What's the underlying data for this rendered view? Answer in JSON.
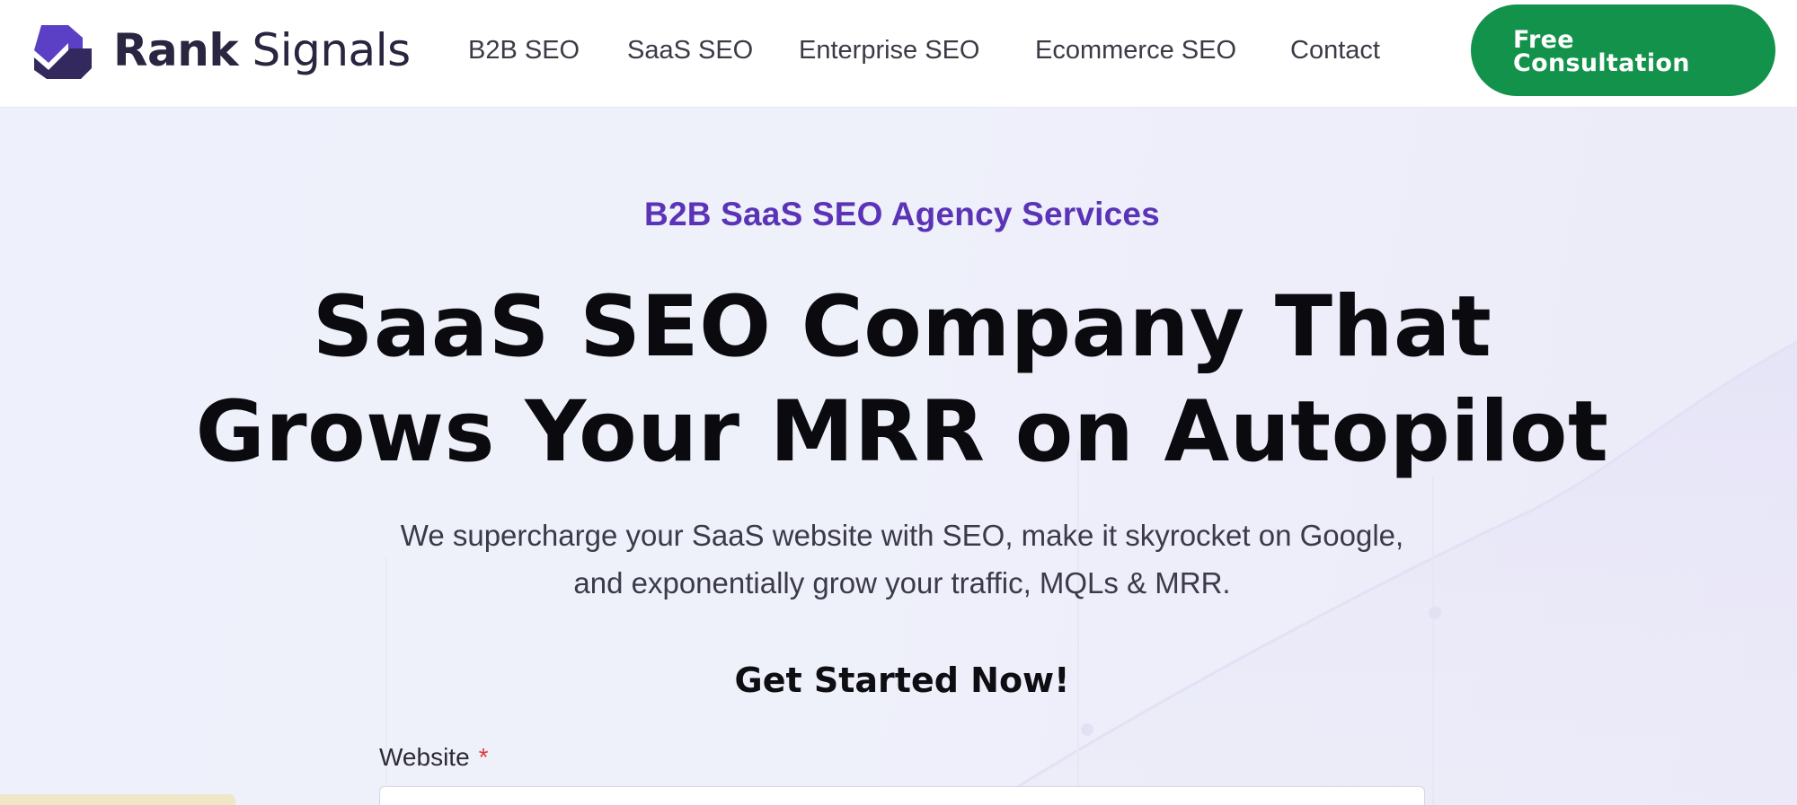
{
  "brand": {
    "name_bold": "Rank",
    "name_light": "Signals",
    "accent": "#3a2a78"
  },
  "nav": {
    "items": [
      "B2B SEO",
      "SaaS SEO",
      "Enterprise SEO",
      "Ecommerce SEO",
      "Contact"
    ],
    "cta_line1": "Free",
    "cta_line2": "Consultation",
    "cta_color": "#12924a"
  },
  "hero": {
    "eyebrow": "B2B SaaS SEO Agency Services",
    "title_line1": "SaaS SEO Company That",
    "title_line2": "Grows Your MRR on Autopilot",
    "subtitle_line1": "We supercharge your SaaS website with SEO, make it skyrocket on Google,",
    "subtitle_line2": "and exponentially grow your traffic, MQLs & MRR."
  },
  "form": {
    "heading": "Get Started Now!",
    "website_label": "Website",
    "required_mark": "*",
    "website_value": ""
  }
}
